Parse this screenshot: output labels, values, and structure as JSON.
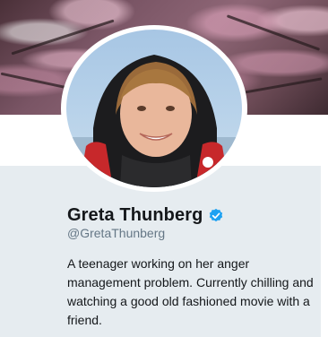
{
  "profile": {
    "display_name": "Greta Thunberg",
    "handle": "@GretaThunberg",
    "verified": true,
    "verified_icon": "verified-badge-icon",
    "bio": "A teenager working on her anger management problem. Currently chilling and watching a good old fashioned movie with a friend."
  },
  "colors": {
    "verified": "#1da1f2",
    "name": "#14171a",
    "handle": "#657786",
    "panel_background": "#e6ecf0"
  }
}
